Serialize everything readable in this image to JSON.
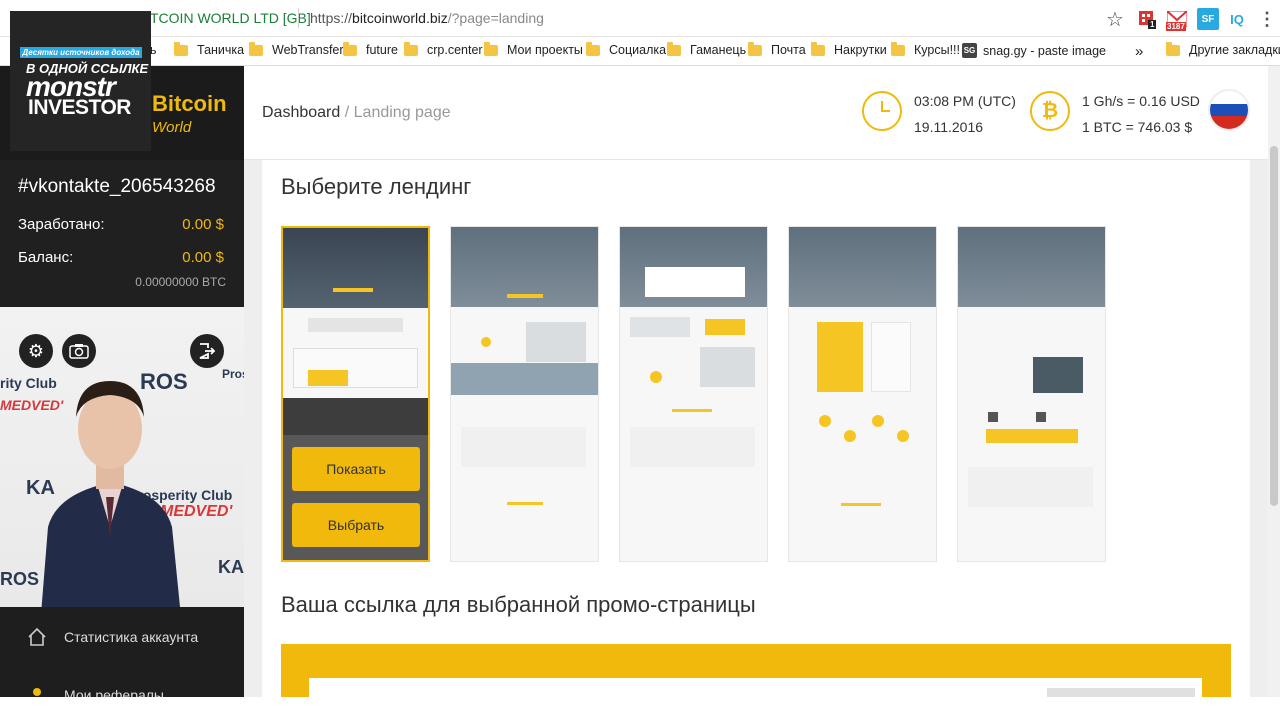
{
  "browser": {
    "tab_title": "TCOIN WORLD LTD [GB]",
    "url_scheme": "https://",
    "url_host": "bitcoinworld.biz",
    "url_path": "/?page=landing",
    "ext_badge_1": "1",
    "ext_badge_2": "3187",
    "ext_sf": "SF",
    "ext_iq": "IQ",
    "star_icon": "☆",
    "menu_icon": "⋮",
    "bookmarks_overflow": "»",
    "bookmarks": [
      {
        "label": "ь"
      },
      {
        "label": "Таничка"
      },
      {
        "label": "WebTransfer"
      },
      {
        "label": "future"
      },
      {
        "label": "crp.center"
      },
      {
        "label": "Мои проекты"
      },
      {
        "label": "Социалка"
      },
      {
        "label": "Гаманець"
      },
      {
        "label": "Почта"
      },
      {
        "label": "Накрутки"
      },
      {
        "label": "Курсы!!!"
      },
      {
        "label": "snag.gy - paste image"
      },
      {
        "label": "Другие закладки"
      }
    ],
    "sg_icon_text": "SG"
  },
  "overlay_logo": {
    "tagline": "Десятки источников дохода",
    "line": "В ОДНОЙ ССЫЛКЕ",
    "name1": "monstr",
    "name2": "INVESTOR"
  },
  "sidebar": {
    "brand_bitcoin": "Bitcoin",
    "brand_world": "World",
    "username": "#vkontakte_206543268",
    "earned_label": "Заработано:",
    "earned_value": "0.00 $",
    "balance_label": "Баланс:",
    "balance_value": "0.00 $",
    "btc_value": "0.00000000 BTC",
    "photo_texts": {
      "club1": "rity Club",
      "medved1": "MEDVED'",
      "ros": "ROS",
      "pros": "Pros",
      "club2": "Prosperity Club",
      "medved2": "MEDVED'",
      "ka": "KA",
      "ros2": "ROS",
      "ka2": "KA"
    },
    "menu": [
      {
        "label": "Статистика аккаунта"
      },
      {
        "label": "Мои рефералы"
      }
    ]
  },
  "topbar": {
    "crumb_root": "Dashboard",
    "crumb_sep": "/",
    "crumb_current": "Landing page",
    "time": "03:08 PM (UTC)",
    "date": "19.11.2016",
    "rate_ghs": "1 Gh/s = 0.16 USD",
    "rate_btc": "1 BTC = 746.03 $",
    "btc_symbol": "₿"
  },
  "main": {
    "choose_title": "Выберите лендинг",
    "show_button": "Показать",
    "select_button": "Выбрать",
    "link_title": "Ваша ссылка для выбранной промо-страницы"
  },
  "colors": {
    "accent": "#f0b90b",
    "sidebar": "#202020"
  }
}
